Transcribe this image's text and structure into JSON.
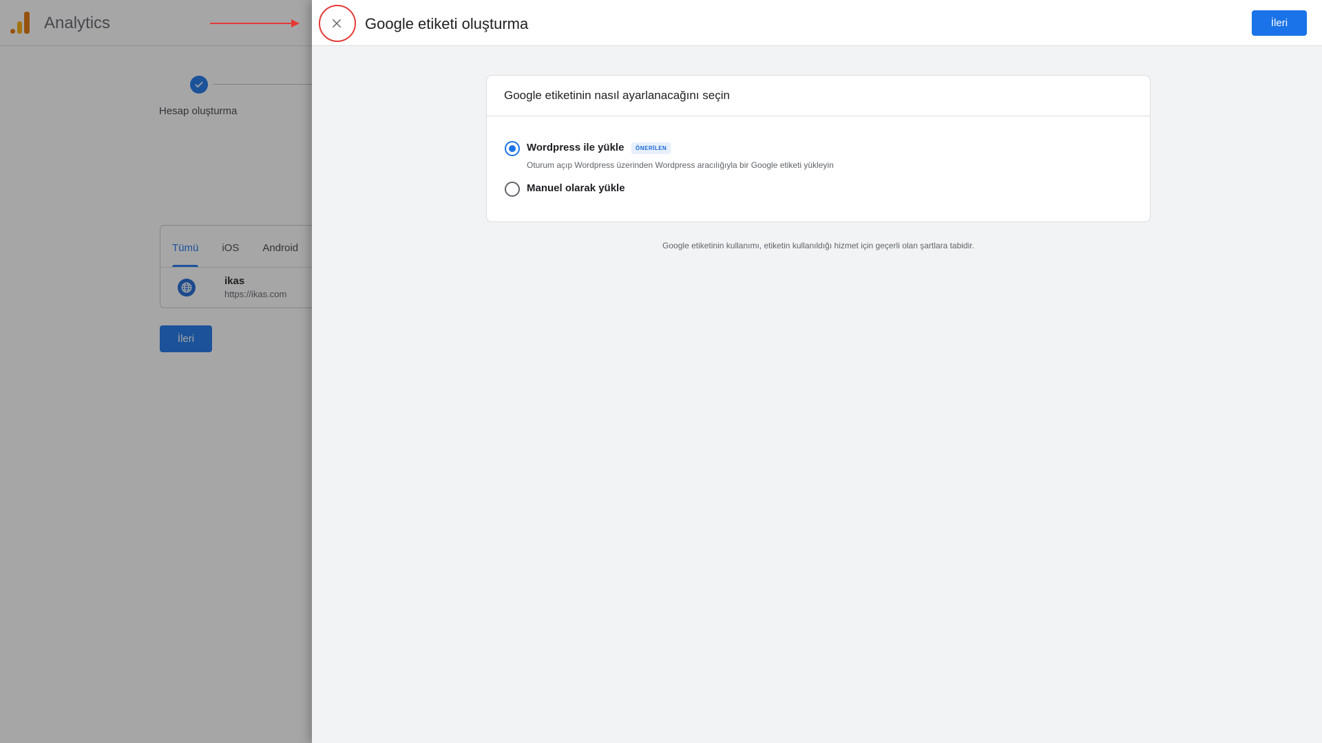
{
  "background": {
    "app_title": "Analytics",
    "step_label": "Hesap oluşturma",
    "tabs": [
      {
        "label": "Tümü",
        "active": true
      },
      {
        "label": "iOS",
        "active": false
      },
      {
        "label": "Android",
        "active": false
      }
    ],
    "stream": {
      "name": "ikas",
      "url": "https://ikas.com",
      "icon": "globe-icon"
    },
    "next_label": "İleri"
  },
  "panel": {
    "title": "Google etiketi oluşturma",
    "close_icon": "close-icon",
    "next_label": "İleri",
    "card_title": "Google etiketinin nasıl ayarlanacağını seçin",
    "options": [
      {
        "label": "Wordpress ile yükle",
        "badge": "ÖNERİLEN",
        "description": "Oturum açıp Wordpress üzerinden Wordpress aracılığıyla bir Google etiketi yükleyin",
        "selected": true
      },
      {
        "label": "Manuel olarak yükle",
        "selected": false
      }
    ],
    "terms": "Google etiketinin kullanımı, etiketin kullanıldığı hizmet için geçerli olan şartlara tabidir."
  },
  "colors": {
    "accent": "#1a73e8",
    "annotation": "#e53935",
    "panel_bg": "#f1f3f4"
  }
}
